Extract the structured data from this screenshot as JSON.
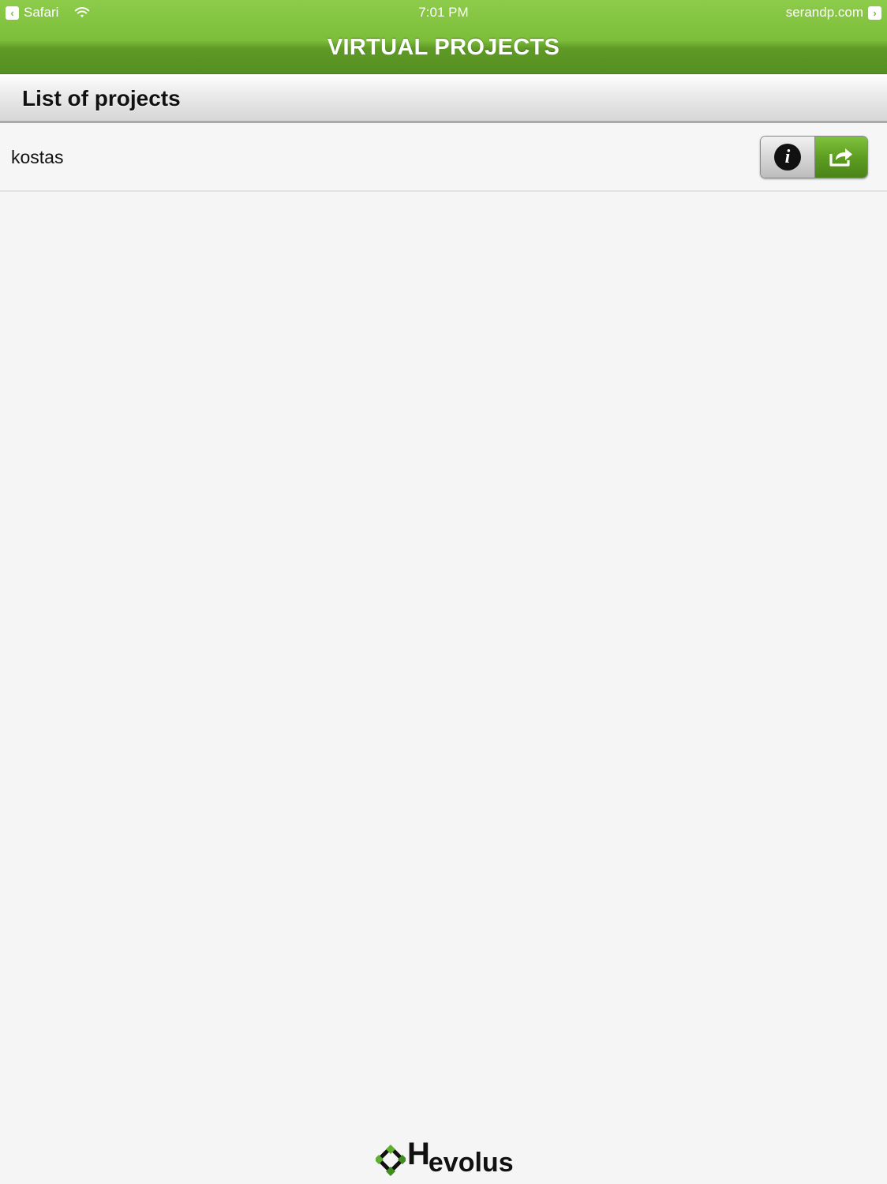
{
  "status_bar": {
    "back_app": "Safari",
    "time": "7:01 PM",
    "domain": "serandp.com",
    "back_glyph": "‹",
    "forward_glyph": "›"
  },
  "header": {
    "title": "VIRTUAL PROJECTS"
  },
  "section": {
    "title": "List of projects"
  },
  "projects": [
    {
      "name": "kostas"
    }
  ],
  "icons": {
    "info": "i",
    "info_icon_name": "info-icon",
    "share_icon_name": "share-icon"
  },
  "footer": {
    "logo_h": "H",
    "logo_rest": "evolus"
  },
  "colors": {
    "header_green": "#7cbd3a",
    "share_green": "#5e9e22",
    "background": "#f5f5f5"
  }
}
